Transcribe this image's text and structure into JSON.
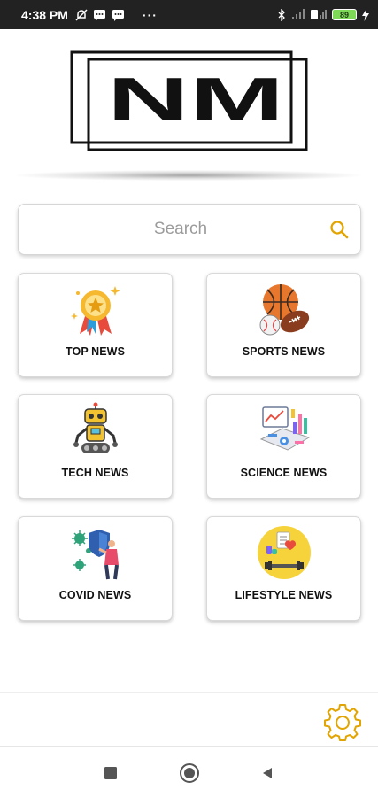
{
  "status_bar": {
    "time": "4:38 PM",
    "dots": "···",
    "battery_level": "89",
    "icons": [
      "mute-icon",
      "message-icon",
      "message-icon",
      "bluetooth-icon",
      "signal-icon",
      "signal-icon",
      "battery-icon",
      "charging-icon"
    ]
  },
  "logo": {
    "text": "NM"
  },
  "search": {
    "placeholder": "Search",
    "value": "",
    "icon": "search-icon",
    "accent": "#e2a400"
  },
  "categories": [
    {
      "label": "TOP NEWS",
      "icon": "award-medal-icon"
    },
    {
      "label": "SPORTS NEWS",
      "icon": "sports-balls-icon"
    },
    {
      "label": "TECH NEWS",
      "icon": "robot-icon"
    },
    {
      "label": "SCIENCE NEWS",
      "icon": "data-analytics-icon"
    },
    {
      "label": "COVID NEWS",
      "icon": "virus-shield-icon"
    },
    {
      "label": "LIFESTYLE NEWS",
      "icon": "health-lifestyle-icon"
    }
  ],
  "settings": {
    "icon": "gear-icon",
    "color": "#e2a400"
  },
  "nav": {
    "recents": "recents-square-icon",
    "home": "home-circle-icon",
    "back": "back-triangle-icon"
  }
}
